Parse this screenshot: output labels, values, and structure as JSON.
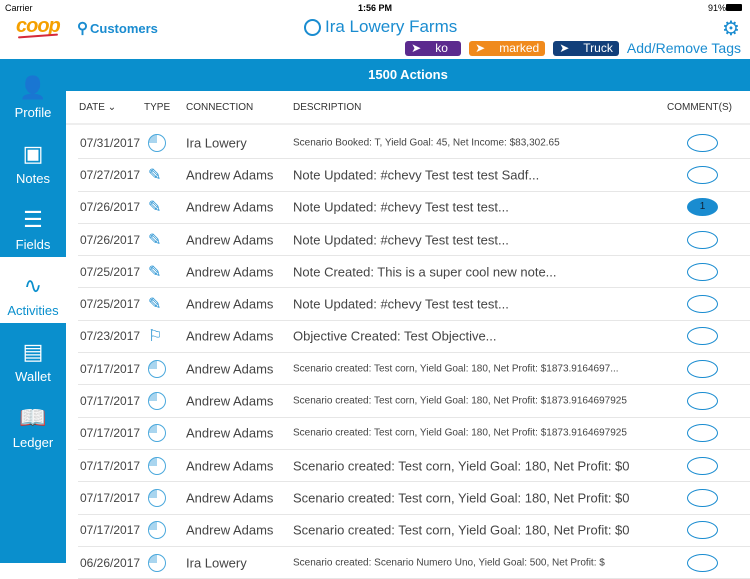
{
  "status": {
    "carrier": "Carrier",
    "time": "1:56 PM",
    "battery": "91%"
  },
  "header": {
    "logo": "coop",
    "customers": "Customers",
    "title": "Ira Lowery Farms",
    "add_tags": "Add/Remove Tags",
    "tags": [
      {
        "label": "ko",
        "color": "#5b2a8e"
      },
      {
        "label": "marked",
        "color": "#f08a1c"
      },
      {
        "label": "Truck",
        "color": "#123f7a"
      }
    ]
  },
  "sidebar": {
    "items": [
      {
        "label": "Profile",
        "icon": "person-icon"
      },
      {
        "label": "Notes",
        "icon": "note-icon"
      },
      {
        "label": "Fields",
        "icon": "layers-icon"
      },
      {
        "label": "Activities",
        "icon": "pulse-icon"
      },
      {
        "label": "Wallet",
        "icon": "money-icon"
      },
      {
        "label": "Ledger",
        "icon": "book-icon"
      }
    ]
  },
  "actions_title": "1500 Actions",
  "columns": {
    "date": "DATE",
    "type": "TYPE",
    "connection": "CONNECTION",
    "description": "DESCRIPTION",
    "comments": "COMMENT(S)"
  },
  "rows": [
    {
      "date": "07/31/2017",
      "type": "scenario",
      "connection": "Ira Lowery",
      "description": "Scenario Booked: T, Yield Goal: 45, Net Income: $83,302.65",
      "small": true,
      "comments": ""
    },
    {
      "date": "07/27/2017",
      "type": "note",
      "connection": "Andrew Adams",
      "description": "Note Updated: #chevy  Test test test  Sadf...",
      "comments": ""
    },
    {
      "date": "07/26/2017",
      "type": "note",
      "connection": "Andrew Adams",
      "description": "Note Updated: #chevy  Test test test...",
      "comments": "1"
    },
    {
      "date": "07/26/2017",
      "type": "note",
      "connection": "Andrew Adams",
      "description": "Note Updated: #chevy  Test test test...",
      "comments": ""
    },
    {
      "date": "07/25/2017",
      "type": "note",
      "connection": "Andrew Adams",
      "description": "Note Created: This is a super cool new note...",
      "comments": ""
    },
    {
      "date": "07/25/2017",
      "type": "note",
      "connection": "Andrew Adams",
      "description": "Note Updated: #chevy  Test test test...",
      "comments": ""
    },
    {
      "date": "07/23/2017",
      "type": "objective",
      "connection": "Andrew Adams",
      "description": "Objective Created: Test Objective...",
      "comments": ""
    },
    {
      "date": "07/17/2017",
      "type": "scenario",
      "connection": "Andrew Adams",
      "description": "Scenario created: Test corn, Yield Goal: 180, Net Profit: $1873.9164697...",
      "small": true,
      "comments": ""
    },
    {
      "date": "07/17/2017",
      "type": "scenario",
      "connection": "Andrew Adams",
      "description": "Scenario created: Test corn, Yield Goal: 180, Net Profit: $1873.9164697925",
      "small": true,
      "comments": ""
    },
    {
      "date": "07/17/2017",
      "type": "scenario",
      "connection": "Andrew Adams",
      "description": "Scenario created: Test corn, Yield Goal: 180, Net Profit: $1873.9164697925",
      "small": true,
      "comments": ""
    },
    {
      "date": "07/17/2017",
      "type": "scenario",
      "connection": "Andrew Adams",
      "description": "Scenario created: Test corn, Yield Goal: 180, Net Profit: $0",
      "comments": ""
    },
    {
      "date": "07/17/2017",
      "type": "scenario",
      "connection": "Andrew Adams",
      "description": "Scenario created: Test corn, Yield Goal: 180, Net Profit: $0",
      "comments": ""
    },
    {
      "date": "07/17/2017",
      "type": "scenario",
      "connection": "Andrew Adams",
      "description": "Scenario created: Test corn, Yield Goal: 180, Net Profit: $0",
      "comments": ""
    },
    {
      "date": "06/26/2017",
      "type": "scenario",
      "connection": "Ira Lowery",
      "description": "Scenario created: Scenario Numero Uno, Yield Goal: 500, Net Profit: $",
      "small": true,
      "comments": ""
    }
  ]
}
